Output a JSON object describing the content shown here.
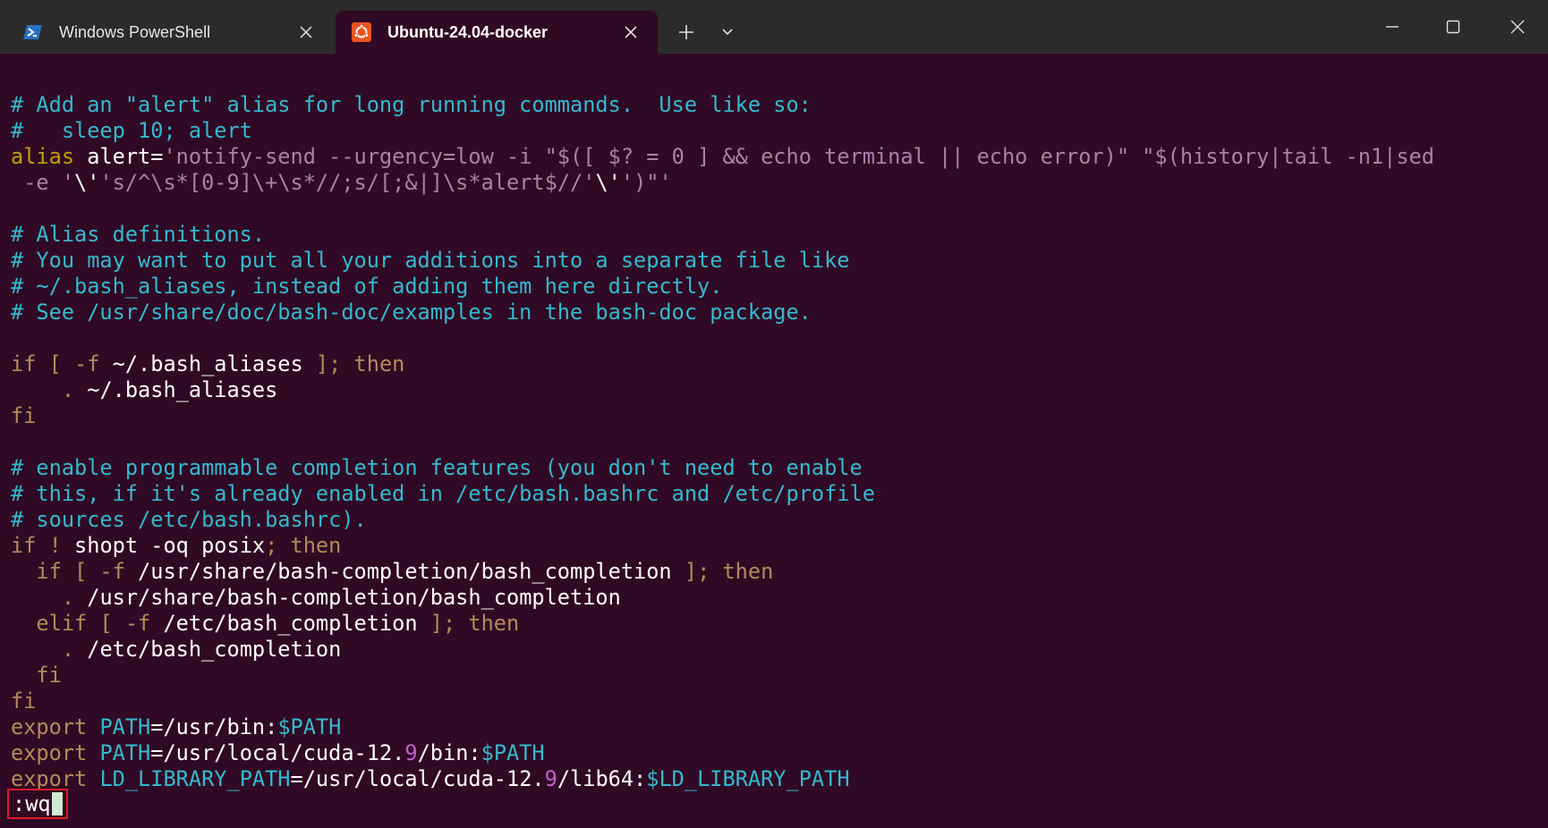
{
  "tabs": [
    {
      "title": "Windows PowerShell",
      "active": false,
      "icon": "powershell-icon"
    },
    {
      "title": "Ubuntu-24.04-docker",
      "active": true,
      "icon": "ubuntu-icon"
    }
  ],
  "colors": {
    "background": "#300a24",
    "titlebar": "#2b2b2b",
    "comment": "#34b9d0",
    "keyword": "#c4a000",
    "string": "#ad7fa8",
    "number": "#c061cb",
    "highlight_box": "#e01b24",
    "cursor": "#cfe9d6"
  },
  "editor": {
    "lines": [
      [
        {
          "t": "# Add an \"alert\" alias for long running commands.  Use like so:",
          "c": "comment"
        }
      ],
      [
        {
          "t": "#   sleep 10; alert",
          "c": "comment"
        }
      ],
      [
        {
          "t": "alias ",
          "c": "kw"
        },
        {
          "t": "alert=",
          "c": "plain"
        },
        {
          "t": "'notify-send --urgency=low -i \"$([ $? = 0 ] && echo terminal || echo error)\" \"$(history|tail -n1|sed",
          "c": "str"
        }
      ],
      [
        {
          "t": " -e '",
          "c": "str"
        },
        {
          "t": "\\'",
          "c": "plain"
        },
        {
          "t": "'s/^\\s*[0-9]\\+\\s*//;s/[;&|]\\s*alert$//'",
          "c": "str"
        },
        {
          "t": "\\'",
          "c": "plain"
        },
        {
          "t": "')\"'",
          "c": "str"
        }
      ],
      [
        {
          "t": "",
          "c": "plain"
        }
      ],
      [
        {
          "t": "# Alias definitions.",
          "c": "comment"
        }
      ],
      [
        {
          "t": "# You may want to put all your additions into a separate file like",
          "c": "comment"
        }
      ],
      [
        {
          "t": "# ~/.bash_aliases, instead of adding them here directly.",
          "c": "comment"
        }
      ],
      [
        {
          "t": "# See /usr/share/doc/bash-doc/examples in the bash-doc package.",
          "c": "comment"
        }
      ],
      [
        {
          "t": "",
          "c": "plain"
        }
      ],
      [
        {
          "t": "if [ -f ",
          "c": "kw2"
        },
        {
          "t": "~/.bash_aliases",
          "c": "plain"
        },
        {
          "t": " ]; then",
          "c": "kw2"
        }
      ],
      [
        {
          "t": "    . ",
          "c": "kw2"
        },
        {
          "t": "~/.bash_aliases",
          "c": "plain"
        }
      ],
      [
        {
          "t": "fi",
          "c": "kw2"
        }
      ],
      [
        {
          "t": "",
          "c": "plain"
        }
      ],
      [
        {
          "t": "# enable programmable completion features (you don't need to enable",
          "c": "comment"
        }
      ],
      [
        {
          "t": "# this, if it's already enabled in /etc/bash.bashrc and /etc/profile",
          "c": "comment"
        }
      ],
      [
        {
          "t": "# sources /etc/bash.bashrc).",
          "c": "comment"
        }
      ],
      [
        {
          "t": "if ! ",
          "c": "kw2"
        },
        {
          "t": "shopt -oq posix",
          "c": "plain"
        },
        {
          "t": "; then",
          "c": "kw2"
        }
      ],
      [
        {
          "t": "  if [ -f ",
          "c": "kw2"
        },
        {
          "t": "/usr/share/bash-completion/bash_completion",
          "c": "plain"
        },
        {
          "t": " ]; then",
          "c": "kw2"
        }
      ],
      [
        {
          "t": "    . ",
          "c": "kw2"
        },
        {
          "t": "/usr/share/bash-completion/bash_completion",
          "c": "plain"
        }
      ],
      [
        {
          "t": "  elif [ -f ",
          "c": "kw2"
        },
        {
          "t": "/etc/bash_completion",
          "c": "plain"
        },
        {
          "t": " ]; then",
          "c": "kw2"
        }
      ],
      [
        {
          "t": "    . ",
          "c": "kw2"
        },
        {
          "t": "/etc/bash_completion",
          "c": "plain"
        }
      ],
      [
        {
          "t": "  fi",
          "c": "kw2"
        }
      ],
      [
        {
          "t": "fi",
          "c": "kw2"
        }
      ],
      [
        {
          "t": "export ",
          "c": "kw2"
        },
        {
          "t": "PATH",
          "c": "var"
        },
        {
          "t": "=/usr/bin:",
          "c": "plain"
        },
        {
          "t": "$PATH",
          "c": "var"
        }
      ],
      [
        {
          "t": "export ",
          "c": "kw2"
        },
        {
          "t": "PATH",
          "c": "var"
        },
        {
          "t": "=/usr/local/cuda-12.",
          "c": "plain"
        },
        {
          "t": "9",
          "c": "num"
        },
        {
          "t": "/bin:",
          "c": "plain"
        },
        {
          "t": "$PATH",
          "c": "var"
        }
      ],
      [
        {
          "t": "export ",
          "c": "kw2"
        },
        {
          "t": "LD_LIBRARY_PATH",
          "c": "var"
        },
        {
          "t": "=/usr/local/cuda-12.",
          "c": "plain"
        },
        {
          "t": "9",
          "c": "num"
        },
        {
          "t": "/lib64:",
          "c": "plain"
        },
        {
          "t": "$LD_LIBRARY_PATH",
          "c": "var"
        }
      ]
    ],
    "command_line": ":wq"
  }
}
